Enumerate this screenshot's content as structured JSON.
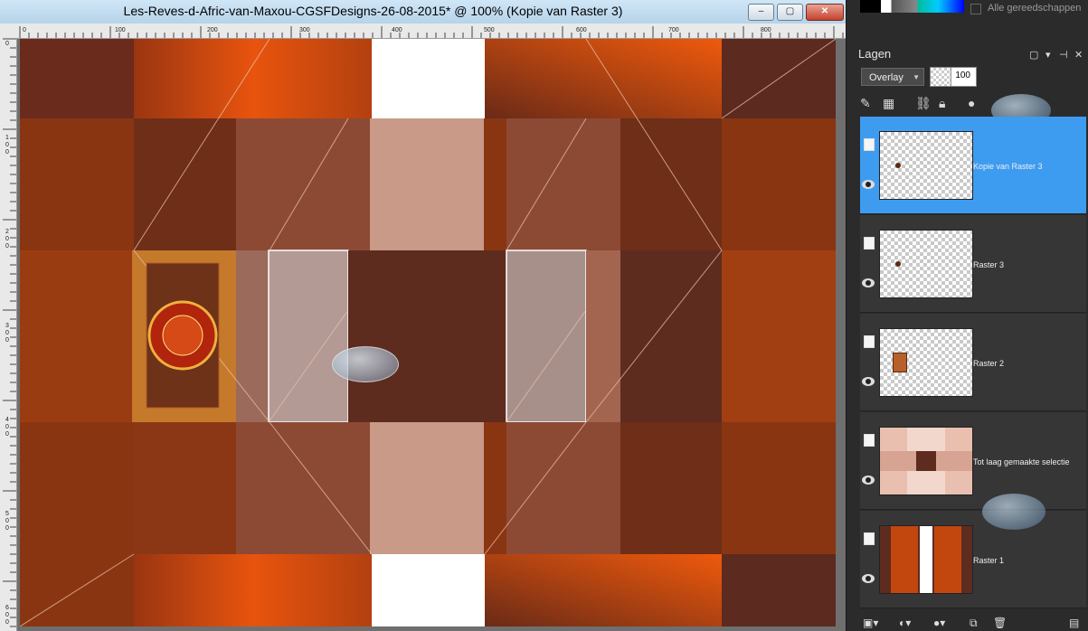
{
  "window": {
    "title": "Les-Reves-d-Afric-van-Maxou-CGSFDesigns-26-08-2015* @ 100% (Kopie van Raster 3)",
    "controls": {
      "minimize": "–",
      "maximize": "▢",
      "close": "✕"
    }
  },
  "rulers": {
    "top_labels": [
      "0",
      "100",
      "200",
      "300",
      "400",
      "500",
      "600",
      "700",
      "800"
    ],
    "left_labels": [
      "0",
      "100",
      "200",
      "300",
      "400",
      "500",
      "600"
    ]
  },
  "canvas": {
    "colors": {
      "dark": "#5e2b1f",
      "orange": "#e2500d",
      "mid": "#8a3b1c",
      "peach": "#c99a88",
      "light": "#a8908a",
      "white": "#ffffff"
    }
  },
  "panel": {
    "all_tools_label": "Alle gereedschappen",
    "layers_title": "Lagen",
    "header_icons": [
      "maximize-icon",
      "dropdown-icon",
      "pin-icon",
      "close-icon"
    ],
    "blend_mode": "Overlay",
    "opacity": "100",
    "toolbar_icons": [
      "brush-icon",
      "mask-icon",
      "link-icon",
      "lock-icon",
      "effects-icon"
    ],
    "layers": [
      {
        "name": "Kopie van Raster 3",
        "selected": true
      },
      {
        "name": "Raster 3",
        "selected": false
      },
      {
        "name": "Raster 2",
        "selected": false
      },
      {
        "name": "Tot laag gemaakte selectie",
        "selected": false
      },
      {
        "name": "Raster 1",
        "selected": false
      }
    ],
    "bottom_icons": [
      "new-layer-icon",
      "new-mask-icon",
      "mask-group-icon",
      "duplicate-icon",
      "delete-icon",
      "properties-icon"
    ]
  }
}
